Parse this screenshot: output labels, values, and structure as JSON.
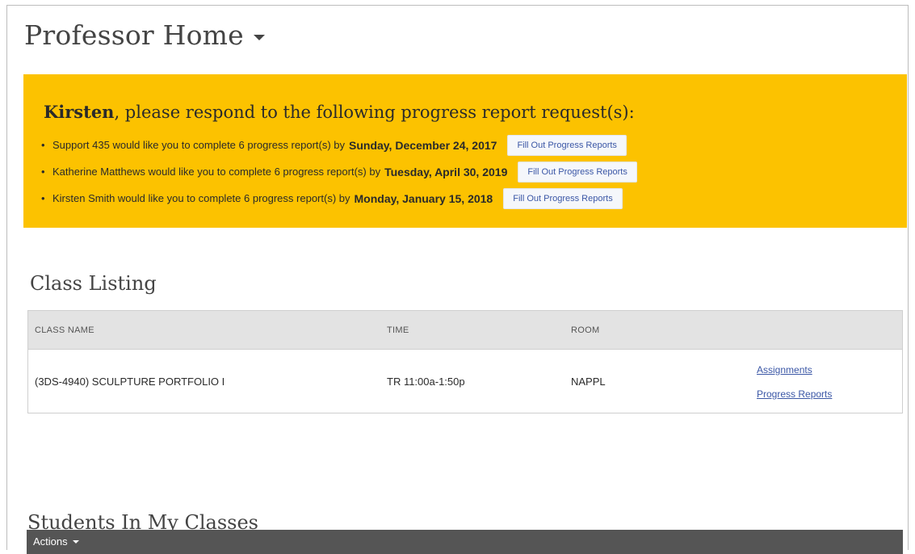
{
  "header": {
    "title": "Professor Home"
  },
  "alert": {
    "name": "Kirsten",
    "message": ", please respond to the following progress report request(s):",
    "requests": [
      {
        "text": "Support 435 would like you to complete 6 progress report(s) by",
        "due": "Sunday, December 24, 2017",
        "button": "Fill Out Progress Reports"
      },
      {
        "text": "Katherine Matthews would like you to complete 6 progress report(s) by",
        "due": "Tuesday, April 30, 2019",
        "button": "Fill Out Progress Reports"
      },
      {
        "text": "Kirsten Smith would like you to complete 6 progress report(s) by",
        "due": "Monday, January 15, 2018",
        "button": "Fill Out Progress Reports"
      }
    ],
    "colors": {
      "background": "#fcc200",
      "button_text": "#3b57a6"
    }
  },
  "class_listing": {
    "title": "Class Listing",
    "columns": [
      "CLASS NAME",
      "TIME",
      "ROOM",
      ""
    ],
    "rows": [
      {
        "class_name": "(3DS-4940) SCULPTURE PORTFOLIO I",
        "time": "TR 11:00a-1:50p",
        "room": "NAPPL",
        "links": [
          "Assignments",
          "Progress Reports"
        ]
      }
    ]
  },
  "students": {
    "title": "Students In My Classes",
    "actions_label": "Actions"
  },
  "icons": {
    "title_dropdown": "chevron-down-icon",
    "actions_dropdown": "chevron-down-icon",
    "bullet": "bullet-icon"
  }
}
